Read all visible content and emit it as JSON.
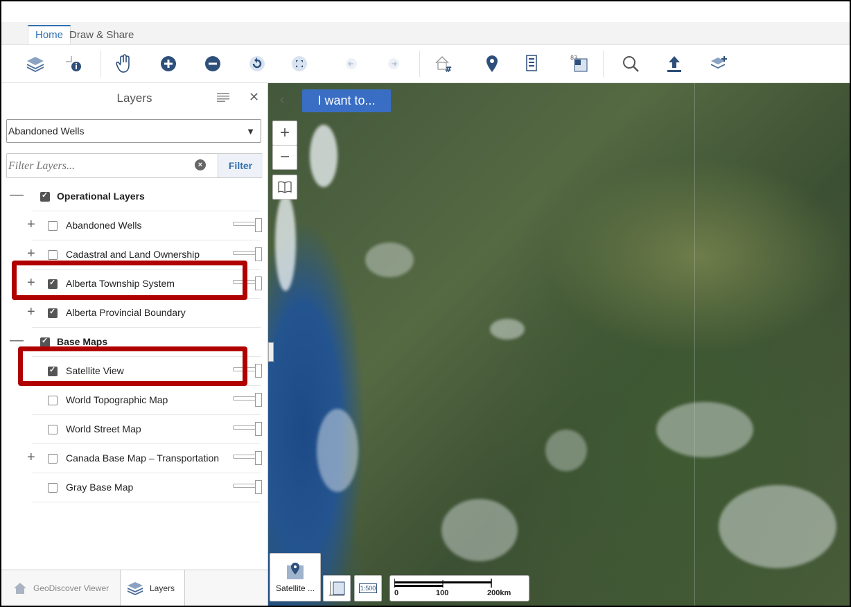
{
  "tabs": [
    {
      "label": "Home",
      "active": true
    },
    {
      "label": "Draw & Share",
      "active": false
    }
  ],
  "toolbar": {
    "buttons": [
      {
        "icon": "layers-icon"
      },
      {
        "icon": "identify-icon"
      },
      {
        "icon": "pan-hand-icon"
      },
      {
        "icon": "zoom-in-icon"
      },
      {
        "icon": "zoom-out-icon"
      },
      {
        "icon": "refresh-icon"
      },
      {
        "icon": "full-extent-icon"
      },
      {
        "icon": "previous-extent-icon"
      },
      {
        "icon": "next-extent-icon"
      },
      {
        "icon": "home-grid-icon"
      },
      {
        "icon": "location-pin-icon"
      },
      {
        "icon": "report-icon"
      },
      {
        "icon": "coordinate-icon"
      },
      {
        "icon": "search-icon"
      },
      {
        "icon": "upload-icon"
      },
      {
        "icon": "add-layer-icon"
      }
    ]
  },
  "panel": {
    "title": "Layers",
    "selected_layer": "Abandoned Wells",
    "filter_placeholder": "Filter Layers...",
    "filter_button": "Filter",
    "groups": [
      {
        "label": "Operational Layers",
        "checked": true,
        "items": [
          {
            "label": "Abandoned Wells",
            "checked": false,
            "expandable": true
          },
          {
            "label": "Cadastral and Land Ownership",
            "checked": false,
            "expandable": true
          },
          {
            "label": "Alberta Township System",
            "checked": true,
            "expandable": true
          },
          {
            "label": "Alberta Provincial Boundary",
            "checked": true,
            "expandable": true
          }
        ]
      },
      {
        "label": "Base Maps",
        "checked": true,
        "items": [
          {
            "label": "Satellite View",
            "checked": true,
            "expandable": false
          },
          {
            "label": "World Topographic Map",
            "checked": false,
            "expandable": false
          },
          {
            "label": "World Street Map",
            "checked": false,
            "expandable": false
          },
          {
            "label": "Canada Base Map – Transportation",
            "checked": false,
            "expandable": true
          },
          {
            "label": "Gray Base Map",
            "checked": false,
            "expandable": false
          }
        ]
      }
    ],
    "bottom_tabs": [
      {
        "label": "GeoDiscover Viewer",
        "active": false
      },
      {
        "label": "Layers",
        "active": true
      }
    ]
  },
  "map": {
    "i_want_to": "I want to...",
    "basemap_label": "Satellite ...",
    "scale_ratio_label": "1:500",
    "scale_labels": [
      "0",
      "100",
      "200km"
    ]
  },
  "colors": {
    "accent": "#2f6fae",
    "button_blue": "#3a6ec4",
    "highlight_red": "#b00000"
  }
}
